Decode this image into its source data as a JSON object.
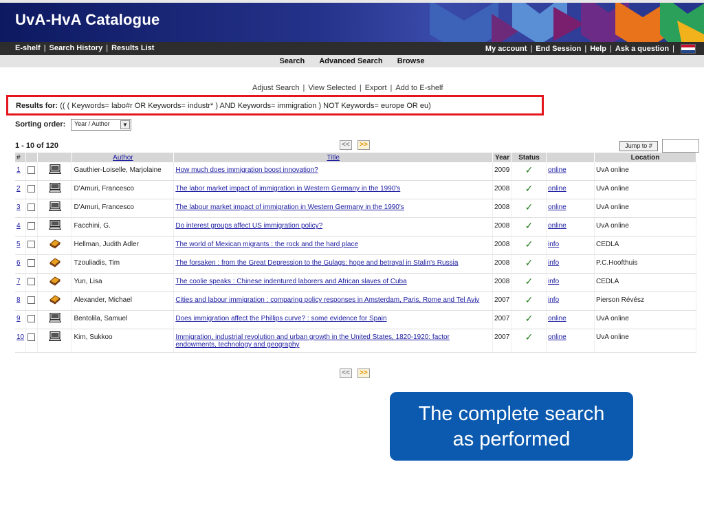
{
  "app": {
    "title": "UvA-HvA Catalogue"
  },
  "menu": {
    "left": [
      "E-shelf",
      "Search History",
      "Results List"
    ],
    "right": [
      "My account",
      "End Session",
      "Help",
      "Ask a question"
    ],
    "separator": "|"
  },
  "subnav": [
    "Search",
    "Advanced Search",
    "Browse"
  ],
  "actions": [
    "Adjust Search",
    "View Selected",
    "Export",
    "Add to E-shelf"
  ],
  "results_for": {
    "label": "Results for:",
    "query": "(( ( Keywords= labo#r OR Keywords= industr* ) AND Keywords= immigration ) NOT Keywords= europe OR eu)"
  },
  "sorting": {
    "label": "Sorting order:",
    "selected": "Year / Author"
  },
  "count": "1 - 10 of 120",
  "pager": {
    "prev": "<<",
    "next": ">>"
  },
  "jump": {
    "button": "Jump to #",
    "value": ""
  },
  "table": {
    "headers": {
      "num": "#",
      "author": "Author",
      "title": "Title",
      "year": "Year",
      "status": "Status",
      "location": "Location"
    },
    "rows": [
      {
        "num": "1",
        "type": "computer-icon",
        "author": "Gauthier-Loiselle, Marjolaine",
        "title": "How much does immigration boost innovation?",
        "year": "2009",
        "status": "✓",
        "link": "online",
        "location": "UvA online"
      },
      {
        "num": "2",
        "type": "computer-icon",
        "author": "D'Amuri, Francesco",
        "title": "The labor market impact of immigration in Western Germany in the 1990's",
        "year": "2008",
        "status": "✓",
        "link": "online",
        "location": "UvA online"
      },
      {
        "num": "3",
        "type": "computer-icon",
        "author": "D'Amuri, Francesco",
        "title": "The labour market impact of immigration in Western Germany in the 1990's",
        "year": "2008",
        "status": "✓",
        "link": "online",
        "location": "UvA online"
      },
      {
        "num": "4",
        "type": "computer-icon",
        "author": "Facchini, G.",
        "title": "Do interest groups affect US immigration policy?",
        "year": "2008",
        "status": "✓",
        "link": "online",
        "location": "UvA online"
      },
      {
        "num": "5",
        "type": "book-icon",
        "author": "Hellman, Judith Adler",
        "title": "The world of Mexican migrants : the rock and the hard place",
        "year": "2008",
        "status": "✓",
        "link": "info",
        "location": "CEDLA"
      },
      {
        "num": "6",
        "type": "book-icon",
        "author": "Tzouliadis, Tim",
        "title": "The forsaken : from the Great Depression to the Gulags: hope and betrayal in Stalin's Russia",
        "year": "2008",
        "status": "✓",
        "link": "info",
        "location": "P.C.Hoofthuis"
      },
      {
        "num": "7",
        "type": "book-icon",
        "author": "Yun, Lisa",
        "title": "The coolie speaks : Chinese indentured laborers and African slaves of Cuba",
        "year": "2008",
        "status": "✓",
        "link": "info",
        "location": "CEDLA"
      },
      {
        "num": "8",
        "type": "book-icon",
        "author": "Alexander, Michael",
        "title": "Cities and labour immigration : comparing policy responses in Amsterdam, Paris, Rome and Tel Aviv",
        "year": "2007",
        "status": "✓",
        "link": "info",
        "location": "Pierson Révész"
      },
      {
        "num": "9",
        "type": "computer-icon",
        "author": "Bentolila, Samuel",
        "title": "Does immigration affect the Phillips curve? : some evidence for Spain",
        "year": "2007",
        "status": "✓",
        "link": "online",
        "location": "UvA online"
      },
      {
        "num": "10",
        "type": "computer-icon",
        "author": "Kim, Sukkoo",
        "title": "Immigration, industrial revolution and urban growth in the United States, 1820-1920: factor endowments, technology and geography",
        "year": "2007",
        "status": "✓",
        "link": "online",
        "location": "UvA online"
      }
    ]
  },
  "callout": {
    "line1": "The complete search",
    "line2": "as performed"
  },
  "colors": {
    "header_dark": "#0d1960",
    "highlight_border": "#e3161c",
    "callout_bg": "#0b5ab0",
    "tick_green": "#1c7a14",
    "link_blue": "#1a1aa0"
  }
}
